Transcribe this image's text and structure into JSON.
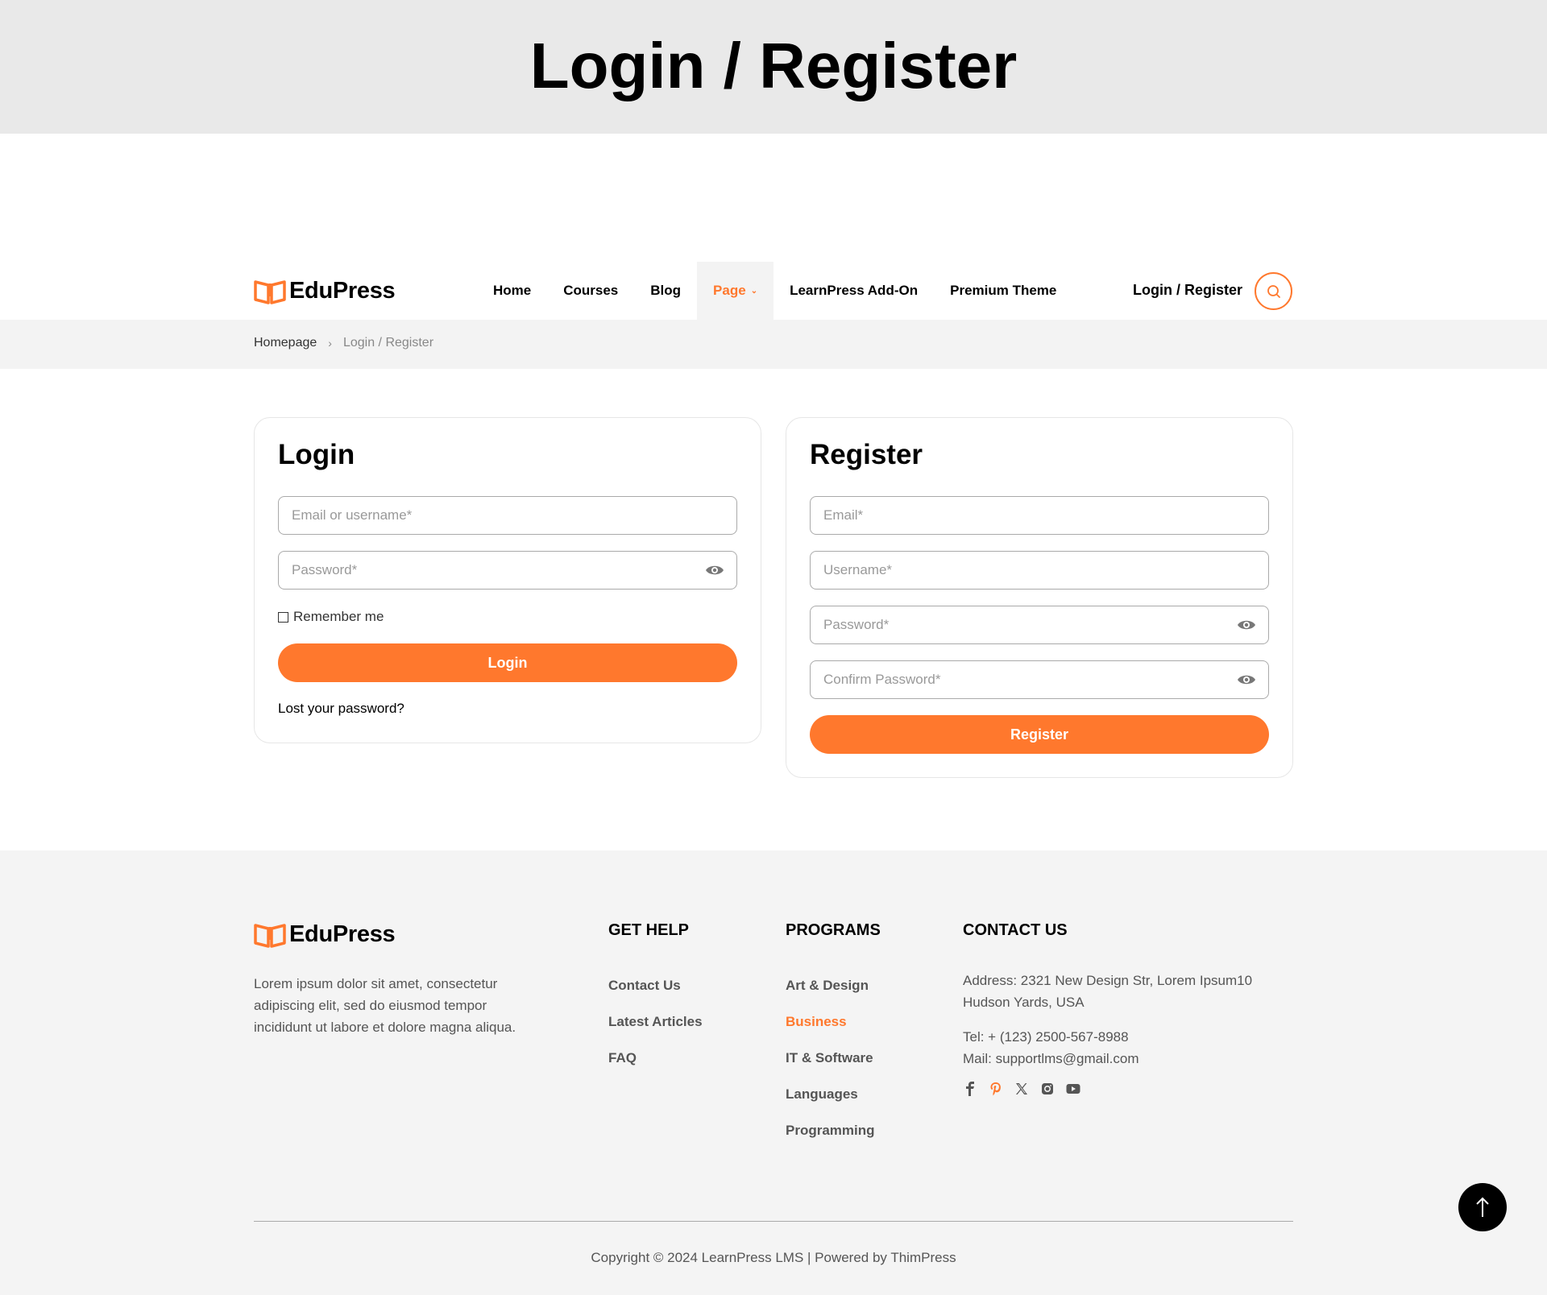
{
  "page_title": "Login / Register",
  "header": {
    "logo_text": "EduPress",
    "nav": [
      {
        "label": "Home"
      },
      {
        "label": "Courses"
      },
      {
        "label": "Blog"
      },
      {
        "label": "Page"
      },
      {
        "label": "LearnPress Add-On"
      },
      {
        "label": "Premium Theme"
      }
    ],
    "active_nav": "Page",
    "auth_link": "Login / Register",
    "search_icon": "search-icon"
  },
  "breadcrumb": {
    "home": "Homepage",
    "separator": "›",
    "current": "Login / Register"
  },
  "login": {
    "title": "Login",
    "email_placeholder": "Email or username*",
    "password_placeholder": "Password*",
    "remember_label": "Remember me",
    "button_label": "Login",
    "lost_password": "Lost your password?"
  },
  "register": {
    "title": "Register",
    "email_placeholder": "Email*",
    "username_placeholder": "Username*",
    "password_placeholder": "Password*",
    "confirm_placeholder": "Confirm Password*",
    "button_label": "Register"
  },
  "footer": {
    "logo_text": "EduPress",
    "description": "Lorem ipsum dolor sit amet, consectetur adipiscing elit, sed do eiusmod tempor incididunt ut labore et dolore magna aliqua.",
    "get_help": {
      "title": "GET HELP",
      "items": [
        "Contact Us",
        "Latest Articles",
        "FAQ"
      ]
    },
    "programs": {
      "title": "PROGRAMS",
      "items": [
        "Art & Design",
        "Business",
        "IT & Software",
        "Languages",
        "Programming"
      ]
    },
    "contact": {
      "title": "CONTACT US",
      "address": "Address: 2321 New Design Str, Lorem Ipsum10 Hudson Yards, USA",
      "tel": "Tel: + (123) 2500-567-8988",
      "mail": "Mail: supportlms@gmail.com"
    },
    "socials": [
      "facebook-icon",
      "pinterest-icon",
      "x-icon",
      "instagram-icon",
      "youtube-icon"
    ],
    "copyright": "Copyright © 2024 LearnPress LMS | Powered by ThimPress"
  },
  "colors": {
    "accent": "#ff782d",
    "title_band": "#e9e9e9",
    "footer_bg": "#f4f4f4"
  }
}
